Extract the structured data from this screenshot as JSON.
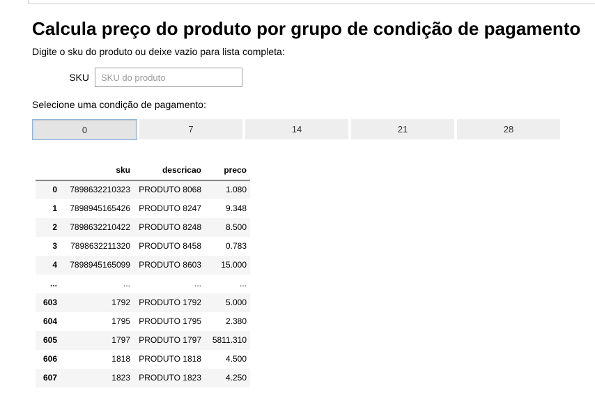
{
  "title": "Calcula preço do produto por grupo de condição de pagamento",
  "instruction": "Digite o sku do produto ou deixe vazio para lista completa:",
  "sku_field": {
    "label": "SKU",
    "placeholder": "SKU do produto",
    "value": ""
  },
  "payment_condition": {
    "label": "Selecione uma condição de pagamento:",
    "options": [
      "0",
      "7",
      "14",
      "21",
      "28"
    ],
    "selected": "0"
  },
  "table": {
    "columns": [
      "",
      "sku",
      "descricao",
      "preco"
    ],
    "rows": [
      [
        "0",
        "7898632210323",
        "PRODUTO 8068",
        "1.080"
      ],
      [
        "1",
        "7898945165426",
        "PRODUTO 8247",
        "9.348"
      ],
      [
        "2",
        "7898632210422",
        "PRODUTO 8248",
        "8.500"
      ],
      [
        "3",
        "7898632211320",
        "PRODUTO 8458",
        "0.783"
      ],
      [
        "4",
        "7898945165099",
        "PRODUTO 8603",
        "15.000"
      ],
      [
        "...",
        "...",
        "...",
        "..."
      ],
      [
        "603",
        "1792",
        "PRODUTO 1792",
        "5.000"
      ],
      [
        "604",
        "1795",
        "PRODUTO 1795",
        "2.380"
      ],
      [
        "605",
        "1797",
        "PRODUTO 1797",
        "5811.310"
      ],
      [
        "606",
        "1818",
        "PRODUTO 1818",
        "4.500"
      ],
      [
        "607",
        "1823",
        "PRODUTO 1823",
        "4.250"
      ]
    ]
  },
  "colors": {
    "selected_border": "#8fb3d9",
    "button_bg": "#eeeeee",
    "row_stripe": "#f5f5f5"
  }
}
